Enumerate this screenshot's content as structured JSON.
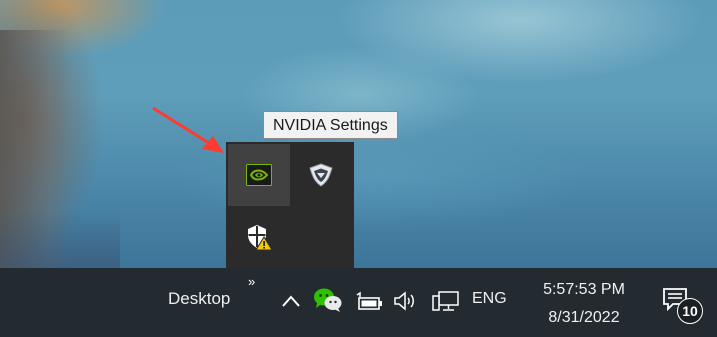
{
  "tooltip": {
    "text": "NVIDIA Settings"
  },
  "flyout": {
    "icons": [
      {
        "name": "nvidia-icon",
        "hovered": true
      },
      {
        "name": "shield-icon",
        "hovered": false
      },
      {
        "name": "windows-security-warning-icon",
        "hovered": false
      }
    ]
  },
  "annotation": {
    "color": "#ff3b30",
    "icon": "red-arrow-icon"
  },
  "taskbar": {
    "desktop_label": "Desktop",
    "toolbar_chevrons": "»",
    "show_hidden_icon": "caret-up-icon",
    "tray_icons": [
      "wechat-icon",
      "battery-icon",
      "volume-icon",
      "network-icon"
    ],
    "language": "ENG",
    "time": "5:57:53 PM",
    "date": "8/31/2022",
    "notification_count": "10"
  },
  "colors": {
    "taskbar_bg": "#232a30",
    "flyout_bg": "#2b2b2b",
    "nvidia_green": "#76b900",
    "wechat_green": "#2dc100",
    "warning_yellow": "#f2c811"
  }
}
